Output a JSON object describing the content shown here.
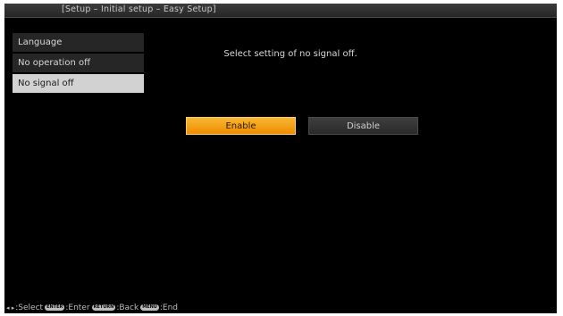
{
  "title": "[Setup – Initial setup – Easy Setup]",
  "menu": {
    "items": [
      {
        "label": "Language",
        "selected": false
      },
      {
        "label": "No operation off",
        "selected": false
      },
      {
        "label": "No signal off",
        "selected": true
      }
    ]
  },
  "main": {
    "prompt": "Select setting of no signal off.",
    "enable_label": "Enable",
    "disable_label": "Disable"
  },
  "footer": {
    "arrows": "◂ ▸",
    "select_label": ":Select",
    "enter_key": "ENTER",
    "enter_label": ":Enter",
    "return_key": "RETURN",
    "back_label": ":Back",
    "menu_key": "MENU",
    "end_label": ":End"
  },
  "colors": {
    "accent": "#f29a0f",
    "selected_item": "#d2d2d2",
    "background": "#000000"
  }
}
